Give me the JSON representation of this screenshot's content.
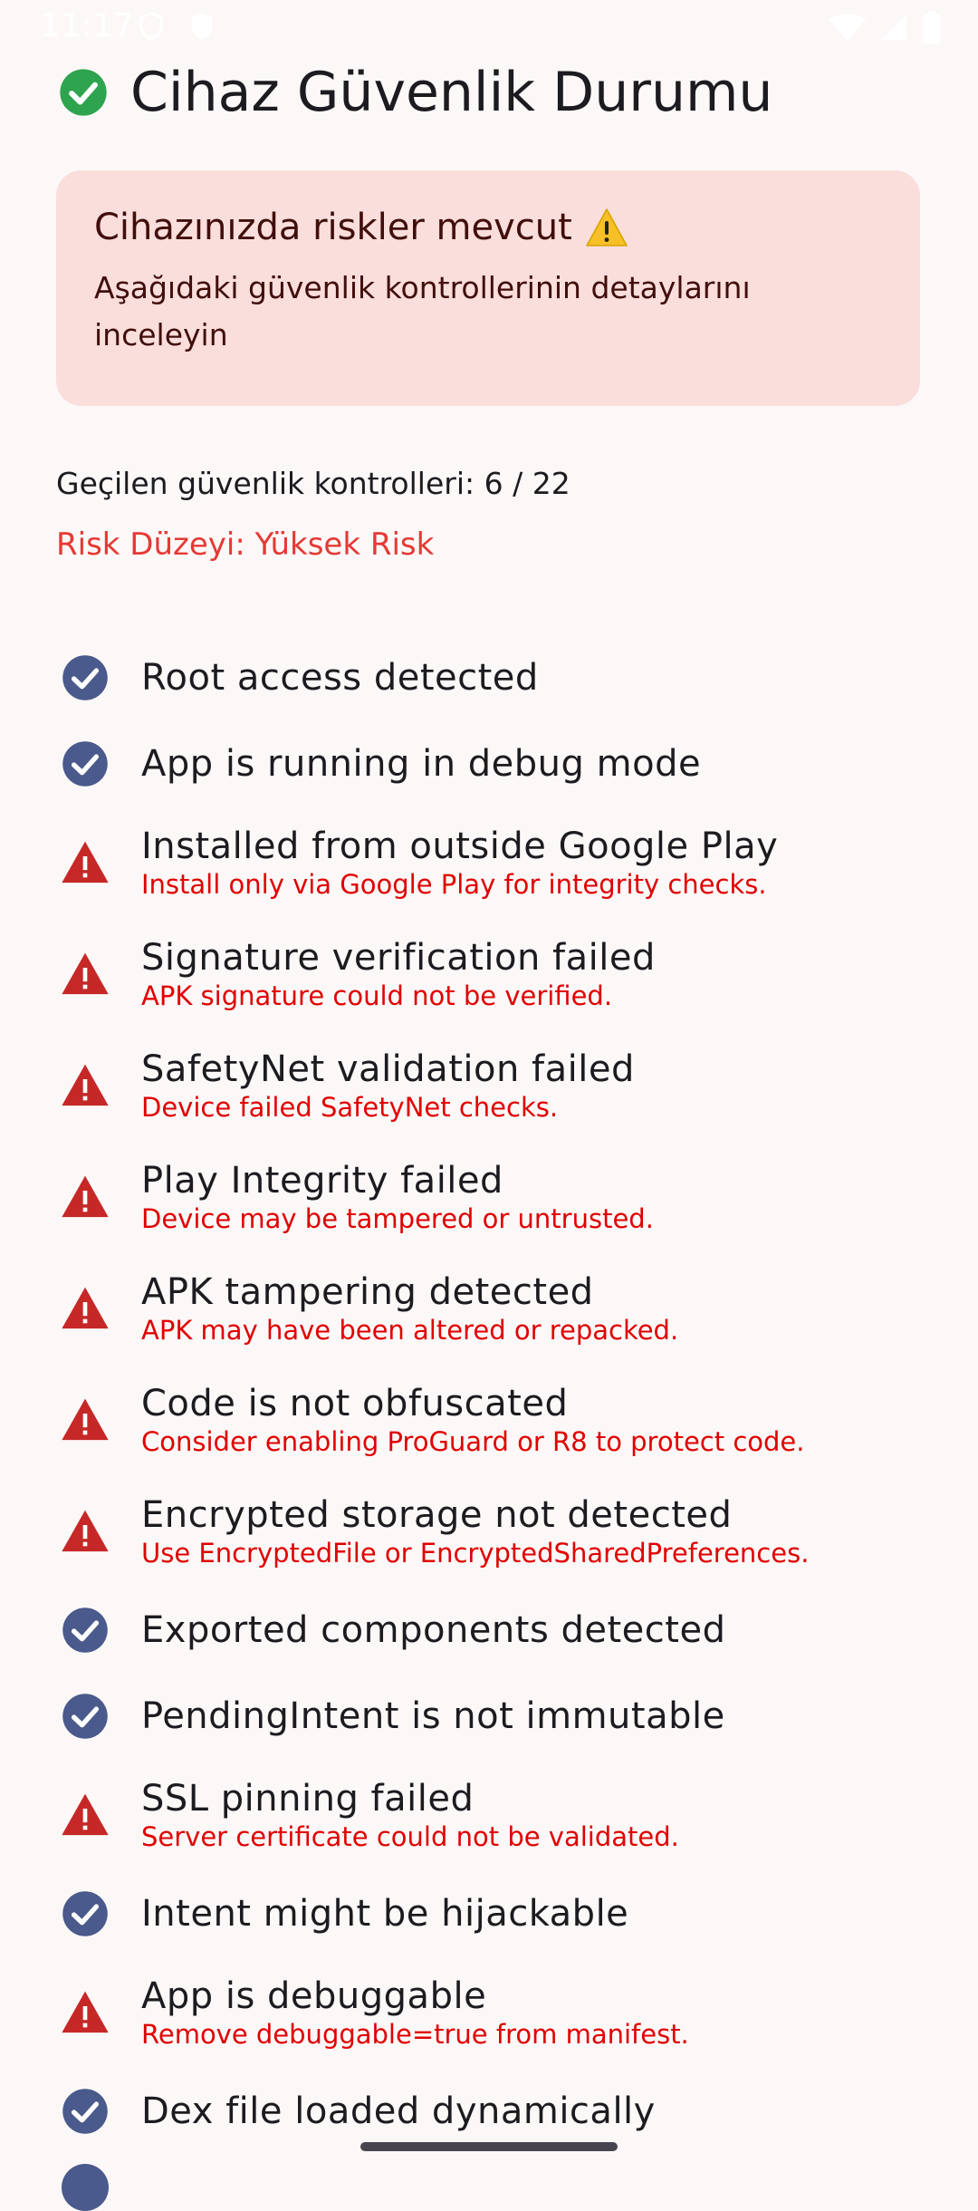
{
  "status_bar": {
    "time": "11:17",
    "icons": [
      "shield-icon",
      "vpn-icon",
      "wifi-icon",
      "signal-icon",
      "battery-icon"
    ]
  },
  "header": {
    "title": "Cihaz Güvenlik Durumu",
    "icon": "check-circle-icon",
    "icon_color": "#2ea44f"
  },
  "alert": {
    "title": "Cihazınızda riskler mevcut",
    "icon": "warning-icon",
    "description": "Aşağıdaki güvenlik kontrollerinin detaylarını inceleyin",
    "background": "#f9dedc"
  },
  "summary": {
    "passed_text": "Geçilen güvenlik kontrolleri: 6 / 22",
    "risk_text": "Risk Düzeyi: Yüksek Risk",
    "risk_color": "#e53935"
  },
  "checks": [
    {
      "status": "pass",
      "title": "Root access detected",
      "detail": ""
    },
    {
      "status": "pass",
      "title": "App is running in debug mode",
      "detail": ""
    },
    {
      "status": "fail",
      "title": "Installed from outside Google Play",
      "detail": "Install only via Google Play for integrity checks."
    },
    {
      "status": "fail",
      "title": "Signature verification failed",
      "detail": "APK signature could not be verified."
    },
    {
      "status": "fail",
      "title": "SafetyNet validation failed",
      "detail": "Device failed SafetyNet checks."
    },
    {
      "status": "fail",
      "title": "Play Integrity failed",
      "detail": "Device may be tampered or untrusted."
    },
    {
      "status": "fail",
      "title": "APK tampering detected",
      "detail": "APK may have been altered or repacked."
    },
    {
      "status": "fail",
      "title": "Code is not obfuscated",
      "detail": "Consider enabling ProGuard or R8 to protect code."
    },
    {
      "status": "fail",
      "title": "Encrypted storage not detected",
      "detail": "Use EncryptedFile or EncryptedSharedPreferences."
    },
    {
      "status": "pass",
      "title": "Exported components detected",
      "detail": ""
    },
    {
      "status": "pass",
      "title": "PendingIntent is not immutable",
      "detail": ""
    },
    {
      "status": "fail",
      "title": "SSL pinning failed",
      "detail": "Server certificate could not be validated."
    },
    {
      "status": "pass",
      "title": "Intent might be hijackable",
      "detail": ""
    },
    {
      "status": "fail",
      "title": "App is debuggable",
      "detail": "Remove debuggable=true from manifest."
    },
    {
      "status": "pass",
      "title": "Dex file loaded dynamically",
      "detail": ""
    }
  ],
  "colors": {
    "pass_icon": "#4a5a8c",
    "fail_icon": "#c62828",
    "detail_text": "#e00000"
  }
}
